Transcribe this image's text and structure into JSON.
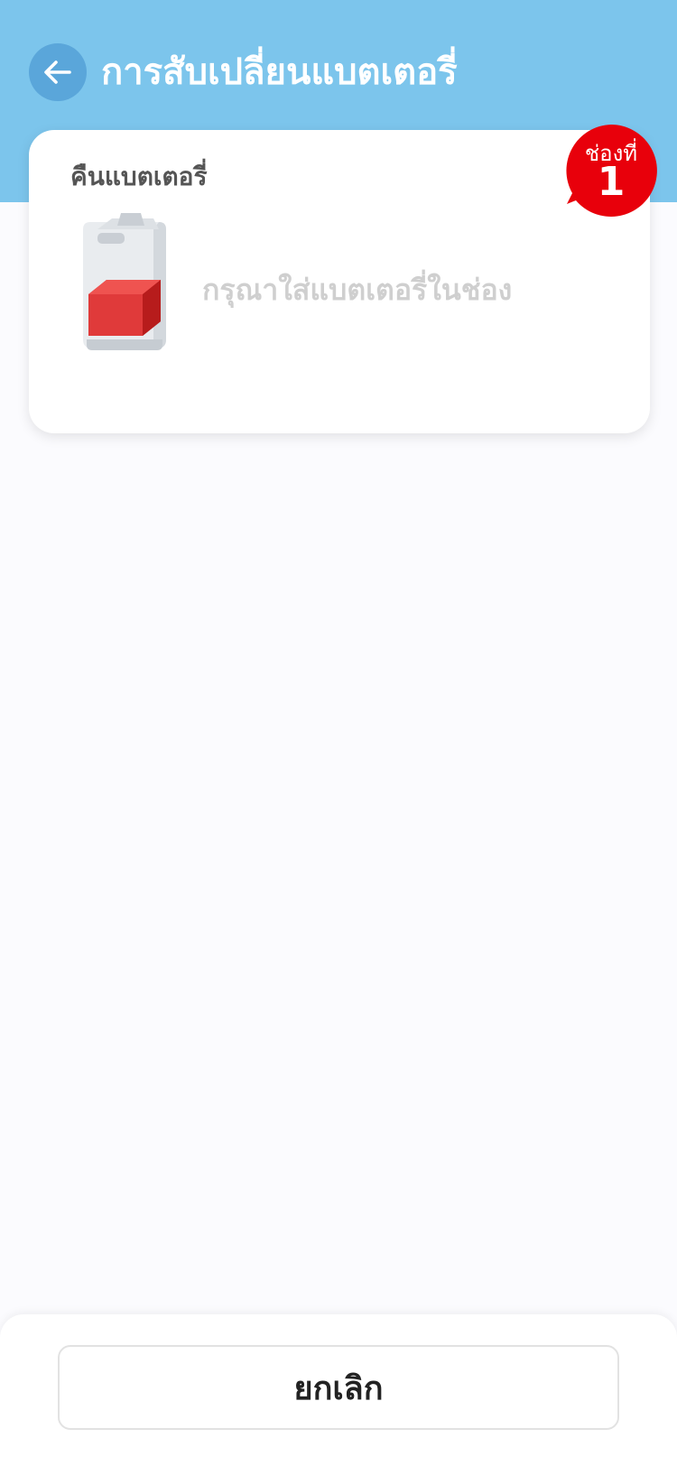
{
  "header": {
    "title": "การสับเปลี่ยนแบตเตอรี่",
    "back_icon": "arrow-left-icon"
  },
  "colors": {
    "header_bg": "#7cc5ec",
    "back_button_bg": "#5aa6da",
    "badge_red": "#e8000b",
    "page_bg": "#fbfbfe",
    "battery_red": "#e03a3a"
  },
  "slot_card": {
    "label": "คืนแบตเตอรี่",
    "instruction": "กรุณาใส่แบตเตอรี่ในช่อง",
    "illustration_icon": "battery-box-icon",
    "badge": {
      "label": "ช่องที่",
      "number": "1"
    }
  },
  "footer": {
    "cancel_label": "ยกเลิก"
  }
}
